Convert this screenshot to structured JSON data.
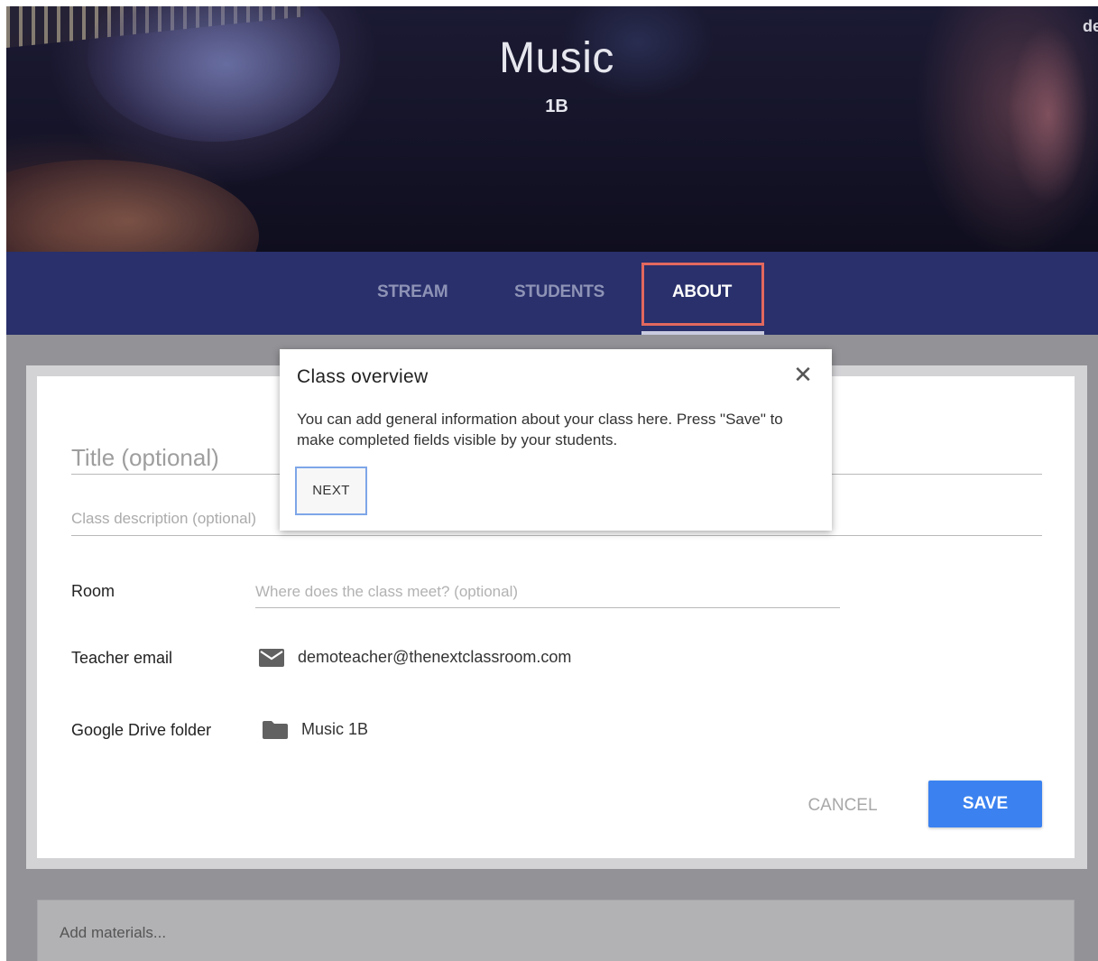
{
  "header": {
    "class_title": "Music",
    "class_section": "1B",
    "corner_user": "de"
  },
  "tabs": [
    {
      "label": "STREAM",
      "active": false
    },
    {
      "label": "STUDENTS",
      "active": false
    },
    {
      "label": "ABOUT",
      "active": true
    }
  ],
  "about_form": {
    "title_placeholder": "Title (optional)",
    "description_placeholder": "Class description (optional)",
    "room_label": "Room",
    "room_placeholder": "Where does the class meet? (optional)",
    "teacher_email_label": "Teacher email",
    "teacher_email_value": "demoteacher@thenextclassroom.com",
    "drive_folder_label": "Google Drive folder",
    "drive_folder_value": "Music 1B",
    "cancel_label": "CANCEL",
    "save_label": "SAVE"
  },
  "materials": {
    "placeholder": "Add materials..."
  },
  "popup": {
    "title": "Class overview",
    "close_glyph": "✕",
    "body": "You can add general information about your class here. Press \"Save\" to make completed fields visible by your students.",
    "next_label": "NEXT"
  },
  "colors": {
    "tab_bar": "#29306b",
    "save_button": "#3b82f0",
    "highlight_box": "#e2685e",
    "next_border": "#7ea6e8"
  }
}
